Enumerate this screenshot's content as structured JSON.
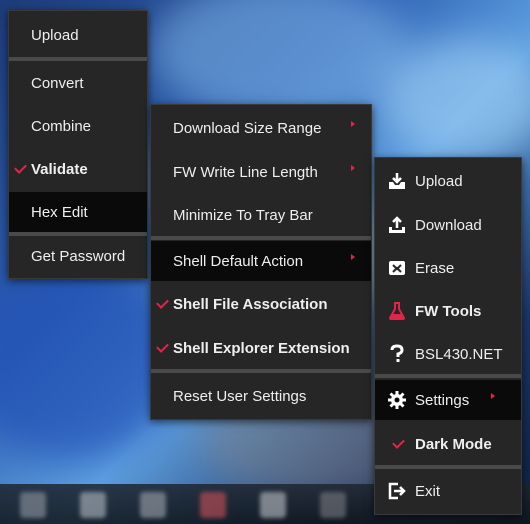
{
  "menu_main": {
    "items": [
      {
        "label": "Upload"
      },
      {
        "label": "Convert"
      },
      {
        "label": "Combine"
      },
      {
        "label": "Validate",
        "checked": true
      },
      {
        "label": "Hex Edit"
      },
      {
        "label": "Get Password"
      }
    ]
  },
  "menu_settings": {
    "items": [
      {
        "label": "Download Size Range"
      },
      {
        "label": "FW Write Line Length"
      },
      {
        "label": "Minimize To Tray Bar"
      },
      {
        "label": "Shell Default Action"
      },
      {
        "label": "Shell File Association",
        "checked": true
      },
      {
        "label": "Shell Explorer Extension",
        "checked": true
      },
      {
        "label": "Reset User Settings"
      }
    ]
  },
  "menu_tray": {
    "items": [
      {
        "label": "Upload",
        "icon": "upload-tray-icon"
      },
      {
        "label": "Download",
        "icon": "download-tray-icon"
      },
      {
        "label": "Erase",
        "icon": "eraser-icon"
      },
      {
        "label": "FW Tools",
        "icon": "flask-icon"
      },
      {
        "label": "BSL430.NET",
        "icon": "question-icon"
      },
      {
        "label": "Settings",
        "icon": "gear-icon"
      },
      {
        "label": "Dark Mode",
        "checked": true
      },
      {
        "label": "Exit",
        "icon": "exit-icon"
      }
    ]
  },
  "colors": {
    "accent": "#e0244a",
    "menu_bg": "#262626",
    "selected_bg": "#0a0a0a",
    "separator": "#4a4a4a"
  }
}
